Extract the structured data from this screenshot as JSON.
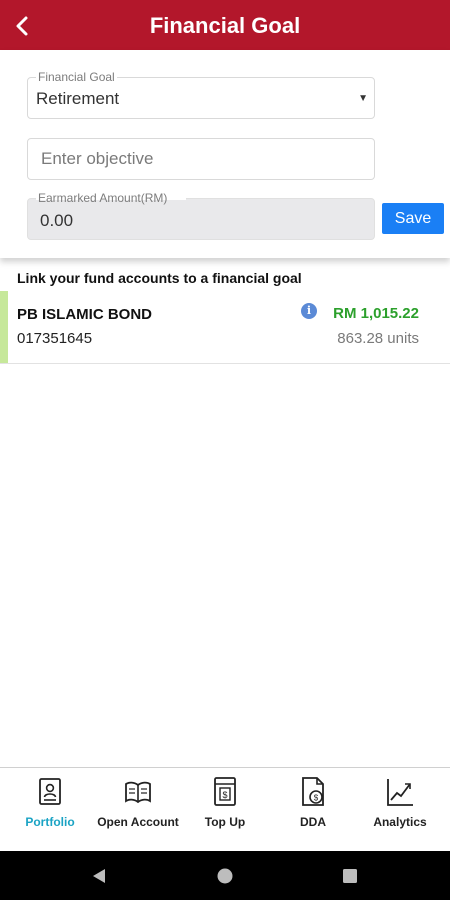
{
  "header": {
    "title": "Financial Goal"
  },
  "form": {
    "goal_label": "Financial Goal",
    "goal_value": "Retirement",
    "objective_placeholder": "Enter objective",
    "amount_label": "Earmarked Amount(RM)",
    "amount_value": "0.00",
    "save_label": "Save"
  },
  "fund_section": {
    "title": "Link your fund accounts to a financial goal",
    "funds": [
      {
        "name": "PB ISLAMIC BOND",
        "account": "017351645",
        "amount": "RM 1,015.22",
        "units": "863.28 units"
      }
    ]
  },
  "bottom_nav": {
    "items": [
      {
        "label": "Portfolio",
        "icon": "portfolio-icon",
        "active": true
      },
      {
        "label": "Open Account",
        "icon": "open-book-icon",
        "active": false
      },
      {
        "label": "Top Up",
        "icon": "calculator-icon",
        "active": false
      },
      {
        "label": "DDA",
        "icon": "dda-document-icon",
        "active": false
      },
      {
        "label": "Analytics",
        "icon": "analytics-chart-icon",
        "active": false
      }
    ]
  },
  "colors": {
    "header": "#b3172b",
    "save_button": "#1a7ff5",
    "amount_green": "#2ca02c",
    "active_nav": "#1aa3c4",
    "fund_accent": "#c6e89a"
  }
}
